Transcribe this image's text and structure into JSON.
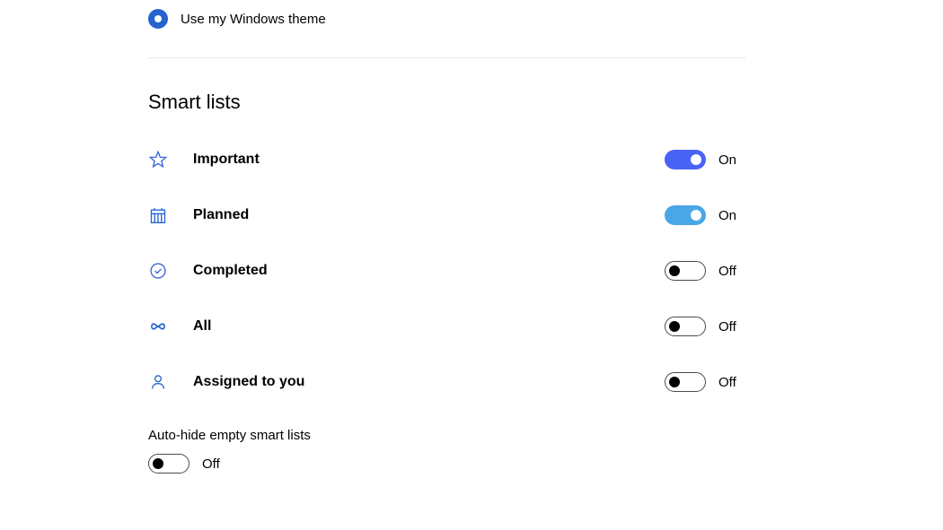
{
  "theme": {
    "use_windows_theme_label": "Use my Windows theme"
  },
  "smart_lists": {
    "heading": "Smart lists",
    "items": {
      "important": {
        "label": "Important",
        "state": "On"
      },
      "planned": {
        "label": "Planned",
        "state": "On"
      },
      "completed": {
        "label": "Completed",
        "state": "Off"
      },
      "all": {
        "label": "All",
        "state": "Off"
      },
      "assigned": {
        "label": "Assigned to you",
        "state": "Off"
      }
    },
    "auto_hide": {
      "label": "Auto-hide empty smart lists",
      "state": "Off"
    }
  }
}
